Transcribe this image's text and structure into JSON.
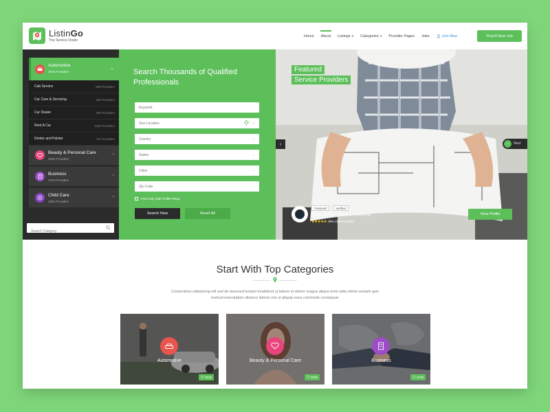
{
  "brand": {
    "name_prefix": "Listin",
    "name_suffix": "Go",
    "tagline": "The Service Finder"
  },
  "nav": {
    "items": [
      {
        "label": "Home"
      },
      {
        "label": "About",
        "active": true
      },
      {
        "label": "Listings",
        "caret": "▾"
      },
      {
        "label": "Categories",
        "caret": "▾"
      },
      {
        "label": "Provider Pages"
      },
      {
        "label": "Jobs"
      }
    ],
    "join": "Join Now",
    "post_job": "Post A New Job"
  },
  "sidebar": {
    "open_category": {
      "title": "Automotive",
      "sub": "3215 Providers",
      "color": "#e8544e"
    },
    "sub_items": [
      {
        "name": "Cab Service",
        "count": "609 Providers"
      },
      {
        "name": "Car Care & Servicing",
        "count": "225 Providers"
      },
      {
        "name": "Car Dealer",
        "count": "490 Providers"
      },
      {
        "name": "Rent A Car",
        "count": "1180 Providers"
      },
      {
        "name": "Denter and Painter",
        "count": "711 Providers"
      }
    ],
    "categories": [
      {
        "title": "Beauty & Personal Care",
        "sub": "3045 Providers",
        "color": "#e8457d"
      },
      {
        "title": "Business",
        "sub": "2478 Providers",
        "color": "#9c4cc7"
      },
      {
        "title": "Child Care",
        "sub": "2655 Providers",
        "color": "#8a44c2"
      }
    ],
    "search_placeholder": "Search Category"
  },
  "search_panel": {
    "title": "Search Thousands of Qualified Professionals",
    "fields": {
      "keyword": "Keyword",
      "geo": "Geo Location",
      "country": "Country",
      "states": "States",
      "cities": "Cities",
      "zip": "Zip Code"
    },
    "checkbox_label": "Find Only With Profile Photo",
    "search_button": "Search Now",
    "reset_button": "Reset All"
  },
  "featured": {
    "label_line1": "Featured",
    "label_line2": "Service Providers",
    "next_label": "Next",
    "tag_featured": "Featured",
    "tag_verified": "Verified",
    "provider_name": "Bright Future Group & Company",
    "stars": "★★★★★",
    "rating_text": "99% (100Reviews)",
    "view_button": "View Profile"
  },
  "top_categories": {
    "title": "Start With Top Categories",
    "description": "Consectetur adipisicing elit sed do eiusmod tempor incididunt ut labore et dolore magna aliqua enim adia minim veniam quis nostrud exercitation ullamco laboris nisi ut aliquip exea commodo consequat.",
    "cards": [
      {
        "label": "Automotive",
        "count": "3215",
        "color": "#e8544e"
      },
      {
        "label": "Beauty & Personal Care",
        "count": "3045",
        "color": "#e8457d"
      },
      {
        "label": "Business",
        "count": "2478",
        "color": "#9c4cc7"
      }
    ]
  },
  "colors": {
    "primary": "#5cbf5a",
    "dark": "#2b2b2b",
    "background": "#7fd67a"
  }
}
